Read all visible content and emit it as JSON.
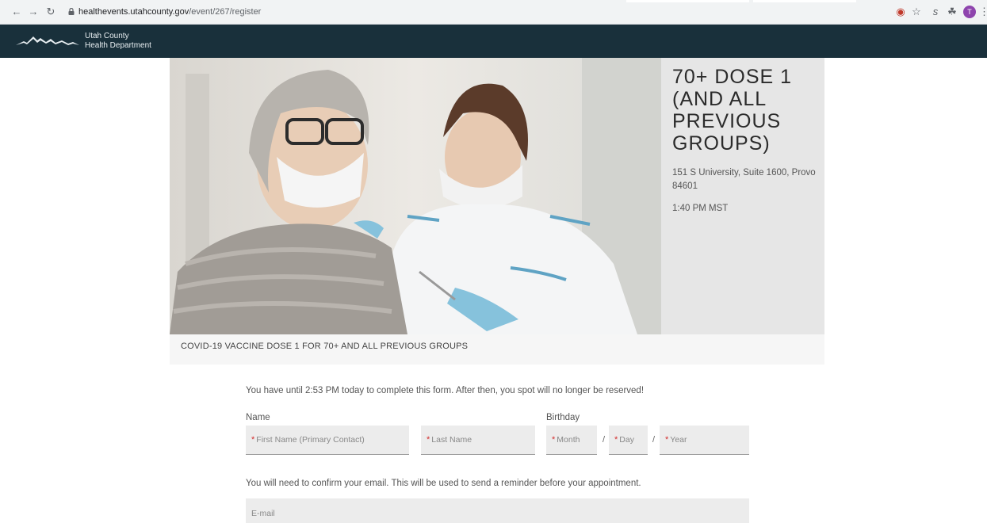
{
  "browser": {
    "url_host": "healthevents.utahcounty.gov",
    "url_path": "/event/267/register",
    "profile_initial": "T"
  },
  "site": {
    "org_line1": "Utah County",
    "org_line2": "Health Department"
  },
  "event": {
    "title": "70+ DOSE 1 (AND ALL PREVIOUS GROUPS)",
    "address": "151 S University, Suite 1600, Provo 84601",
    "time": "1:40 PM MST",
    "caption": "COVID-19 VACCINE DOSE 1 FOR 70+ AND ALL PREVIOUS GROUPS"
  },
  "form": {
    "notice": "You have until 2:53 PM today to complete this form. After then, you spot will no longer be reserved!",
    "name_label": "Name",
    "birthday_label": "Birthday",
    "required_mark": "*",
    "first_name_placeholder": "First Name (Primary Contact)",
    "last_name_placeholder": "Last Name",
    "month_placeholder": "Month",
    "day_placeholder": "Day",
    "year_placeholder": "Year",
    "date_separator": "/",
    "email_note": "You will need to confirm your email. This will be used to send a reminder before your appointment.",
    "email_placeholder": "E-mail"
  },
  "colors": {
    "header_bg": "#19303b",
    "required": "#d32f2f",
    "field_bg": "#ececec"
  }
}
